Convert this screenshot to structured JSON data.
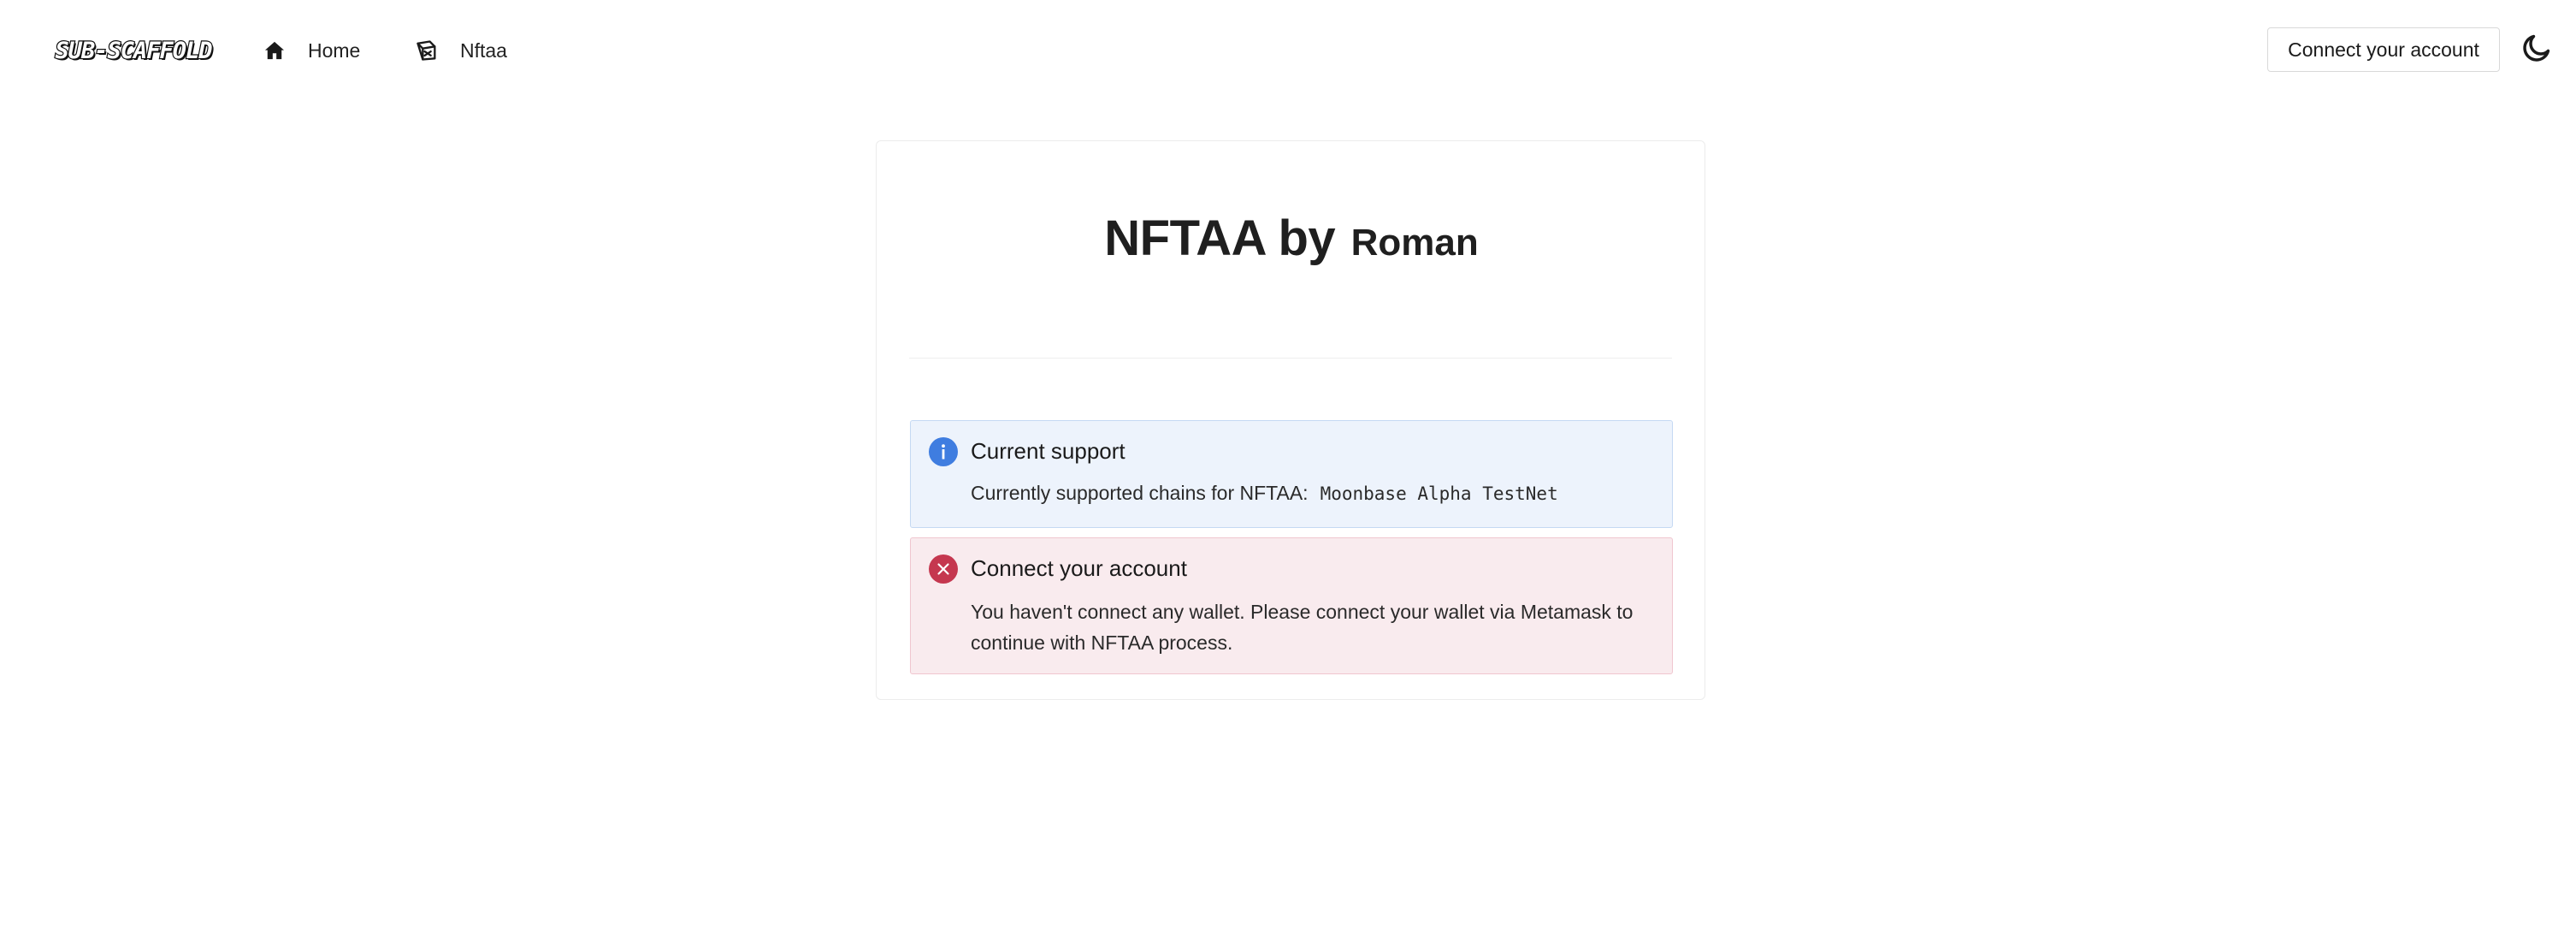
{
  "navbar": {
    "logo_text": "SUB-SCAFFOLD",
    "items": [
      {
        "label": "Home",
        "icon": "home-icon"
      },
      {
        "label": "Nftaa",
        "icon": "nftaa-icon"
      }
    ],
    "connect_label": "Connect your account",
    "theme_icon": "moon-icon"
  },
  "card": {
    "title": "NFTAA by",
    "author": "Roman"
  },
  "alerts": {
    "info": {
      "icon": "info-icon",
      "title": "Current support",
      "body": "Currently supported chains for NFTAA:",
      "chain": "Moonbase Alpha TestNet"
    },
    "error": {
      "icon": "error-icon",
      "title": "Connect your account",
      "body": "You haven't connect any wallet. Please connect your wallet via Metamask to continue with NFTAA process."
    }
  },
  "colors": {
    "info_accent": "#3f7de0",
    "info_background": "#edf3fc",
    "error_accent": "#c5374f",
    "error_background": "#f9ebee"
  }
}
